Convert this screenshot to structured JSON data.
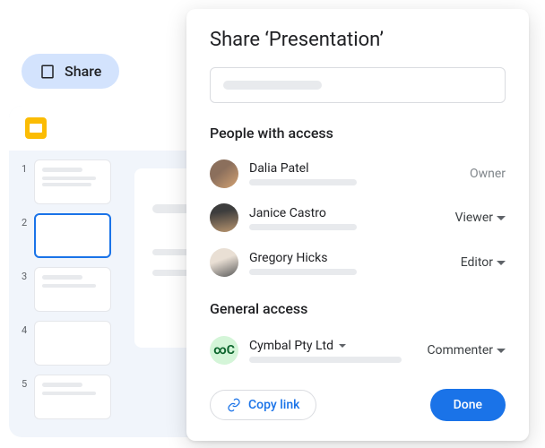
{
  "share_button_label": "Share",
  "dialog": {
    "title": "Share ‘Presentation’",
    "people_section_title": "People with access",
    "general_section_title": "General access",
    "people": [
      {
        "name": "Dalia Patel",
        "role": "Owner",
        "role_type": "owner"
      },
      {
        "name": "Janice Castro",
        "role": "Viewer",
        "role_type": "dropdown"
      },
      {
        "name": "Gregory Hicks",
        "role": "Editor",
        "role_type": "dropdown"
      }
    ],
    "general": {
      "org_name": "Cymbal Pty Ltd",
      "org_badge": "∞C",
      "role": "Commenter"
    },
    "copy_link_label": "Copy link",
    "done_label": "Done"
  },
  "slides": {
    "thumb_numbers": [
      "1",
      "2",
      "3",
      "4",
      "5"
    ],
    "active_index": 1
  }
}
